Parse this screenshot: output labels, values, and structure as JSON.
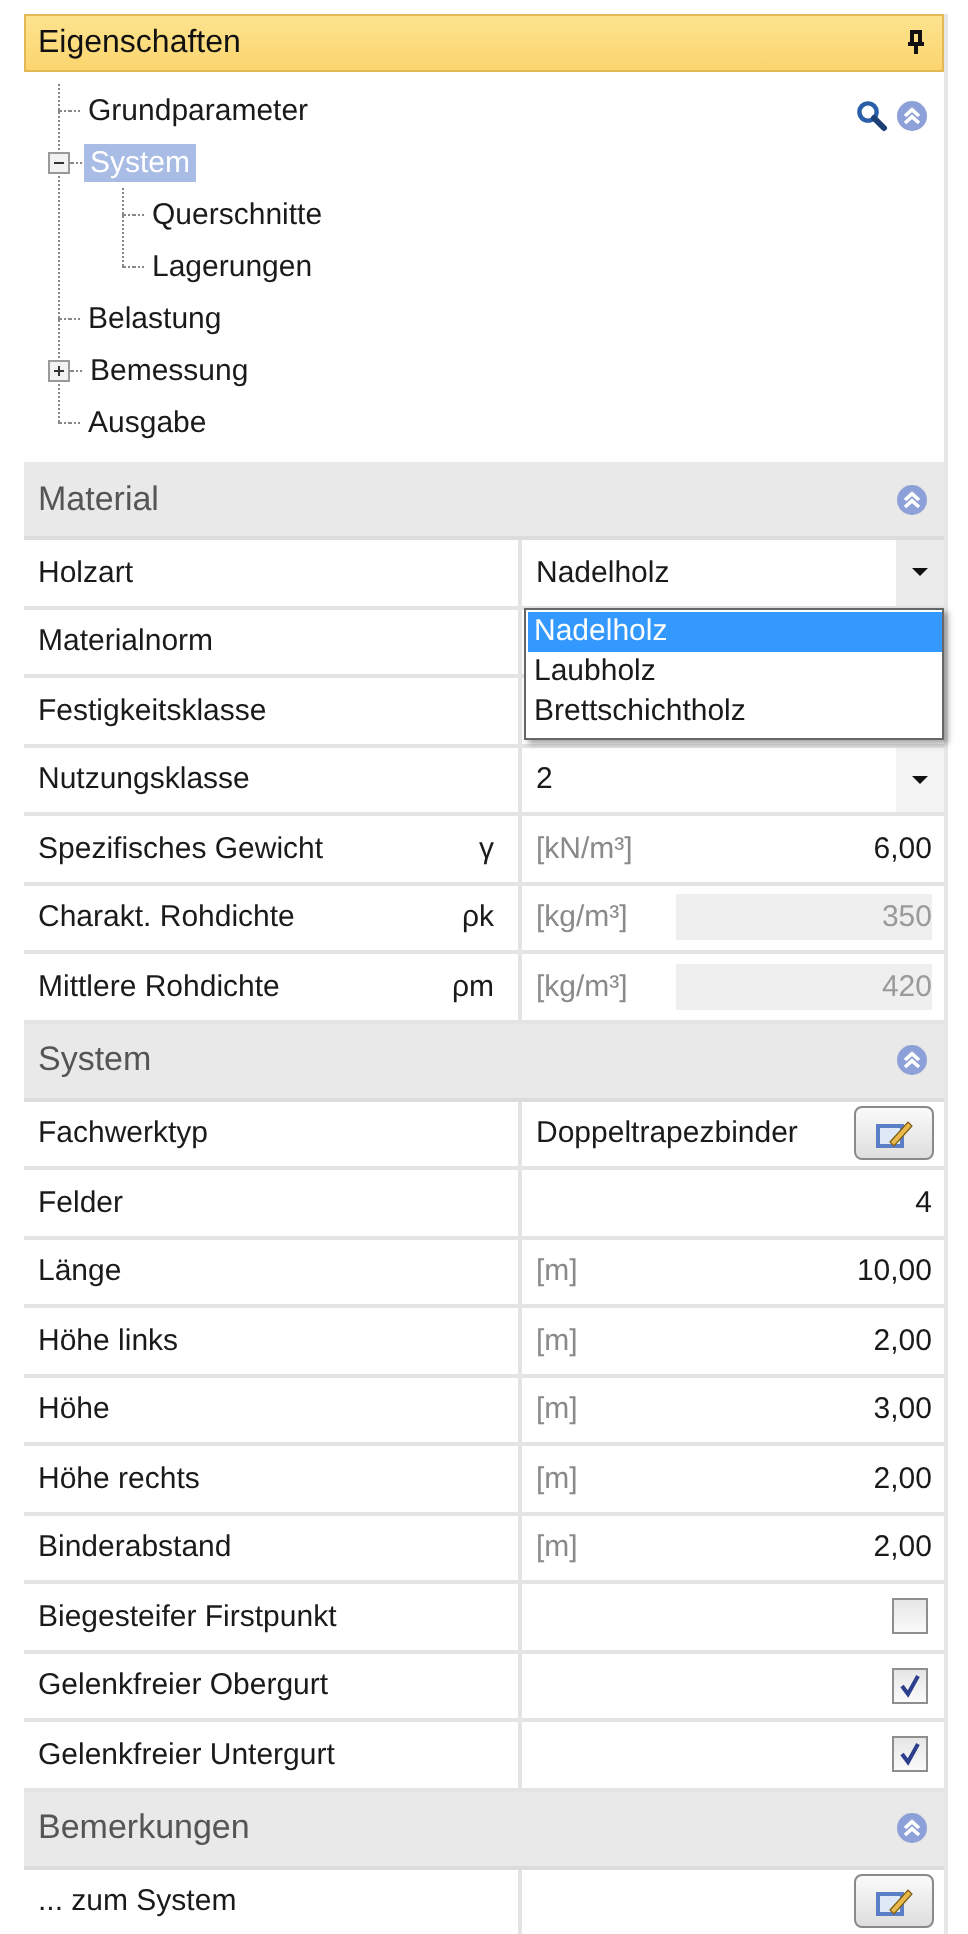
{
  "panel": {
    "title": "Eigenschaften"
  },
  "tree": {
    "nodes": [
      {
        "label": "Grundparameter",
        "selected": false
      },
      {
        "label": "System",
        "selected": true,
        "expanded": true,
        "children": [
          {
            "label": "Querschnitte",
            "selected": false
          },
          {
            "label": "Lagerungen",
            "selected": false
          }
        ]
      },
      {
        "label": "Belastung",
        "selected": false
      },
      {
        "label": "Bemessung",
        "selected": false,
        "expanded": false
      },
      {
        "label": "Ausgabe",
        "selected": false
      }
    ]
  },
  "sections": [
    {
      "title": "Material",
      "expanded": true,
      "rows": [
        {
          "kind": "dropdown",
          "label": "Holzart",
          "value": "Nadelholz",
          "open": true,
          "options": [
            {
              "label": "Nadelholz",
              "selected": true
            },
            {
              "label": "Laubholz",
              "selected": false
            },
            {
              "label": "Brettschichtholz",
              "selected": false
            }
          ]
        },
        {
          "kind": "value",
          "label": "Materialnorm"
        },
        {
          "kind": "value",
          "label": "Festigkeitsklasse"
        },
        {
          "kind": "dropdown",
          "label": "Nutzungsklasse",
          "value": "2"
        },
        {
          "kind": "value",
          "label": "Spezifisches Gewicht",
          "symbol": "γ",
          "unit": "[kN/m³]",
          "value": "6,00"
        },
        {
          "kind": "value",
          "label": "Charakt. Rohdichte",
          "symbol": "ρk",
          "unit": "[kg/m³]",
          "value": "350",
          "readonly": true
        },
        {
          "kind": "value",
          "label": "Mittlere Rohdichte",
          "symbol": "ρm",
          "unit": "[kg/m³]",
          "value": "420",
          "readonly": true
        }
      ]
    },
    {
      "title": "System",
      "expanded": true,
      "rows": [
        {
          "kind": "button",
          "label": "Fachwerktyp",
          "value": "Doppeltrapezbinder"
        },
        {
          "kind": "value",
          "label": "Felder",
          "value": "4"
        },
        {
          "kind": "value",
          "label": "Länge",
          "unit": "[m]",
          "value": "10,00"
        },
        {
          "kind": "value",
          "label": "Höhe links",
          "unit": "[m]",
          "value": "2,00"
        },
        {
          "kind": "value",
          "label": "Höhe",
          "unit": "[m]",
          "value": "3,00"
        },
        {
          "kind": "value",
          "label": "Höhe rechts",
          "unit": "[m]",
          "value": "2,00"
        },
        {
          "kind": "value",
          "label": "Binderabstand",
          "unit": "[m]",
          "value": "2,00"
        },
        {
          "kind": "checkbox",
          "label": "Biegesteifer Firstpunkt",
          "checked": false
        },
        {
          "kind": "checkbox",
          "label": "Gelenkfreier Obergurt",
          "checked": true
        },
        {
          "kind": "checkbox",
          "label": "Gelenkfreier Untergurt",
          "checked": true
        }
      ]
    },
    {
      "title": "Bemerkungen",
      "expanded": true,
      "rows": [
        {
          "kind": "button",
          "label": "... zum System"
        }
      ]
    }
  ]
}
